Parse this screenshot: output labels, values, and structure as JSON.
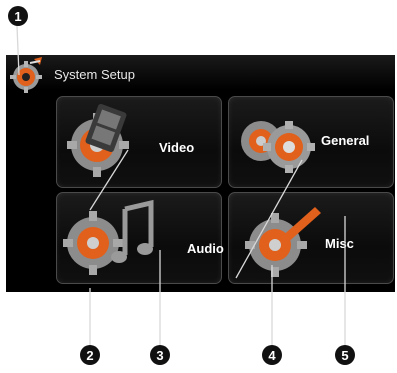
{
  "header": {
    "title": "System Setup",
    "icon": "system-setup-gear-icon"
  },
  "tiles": [
    {
      "label": "Video",
      "icon": "video-gear-icon"
    },
    {
      "label": "General",
      "icon": "general-gear-icon"
    },
    {
      "label": "Audio",
      "icon": "audio-gear-icon"
    },
    {
      "label": "Misc",
      "icon": "misc-gear-icon"
    }
  ],
  "callouts": [
    "1",
    "2",
    "3",
    "4",
    "5"
  ],
  "colors": {
    "accent": "#e0601c",
    "screen": "#000000",
    "tile_border": "#4a4a4a"
  }
}
